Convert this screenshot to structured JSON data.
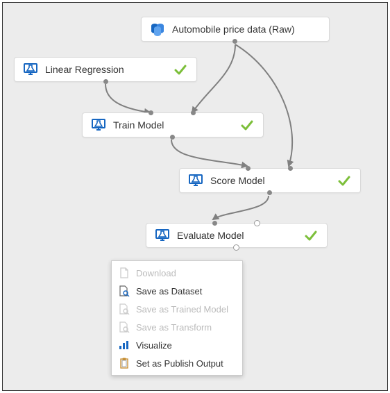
{
  "nodes": {
    "dataset": {
      "label": "Automobile price data (Raw)"
    },
    "linreg": {
      "label": "Linear Regression"
    },
    "train": {
      "label": "Train Model"
    },
    "score": {
      "label": "Score Model"
    },
    "evaluate": {
      "label": "Evaluate Model"
    }
  },
  "menu": {
    "download": "Download",
    "save_dataset": "Save as Dataset",
    "save_trained_model": "Save as Trained Model",
    "save_transform": "Save as Transform",
    "visualize": "Visualize",
    "set_publish_output": "Set as Publish Output"
  },
  "colors": {
    "icon_blue": "#1666c1",
    "check_green": "#7cbf3a",
    "connector": "#808080"
  }
}
